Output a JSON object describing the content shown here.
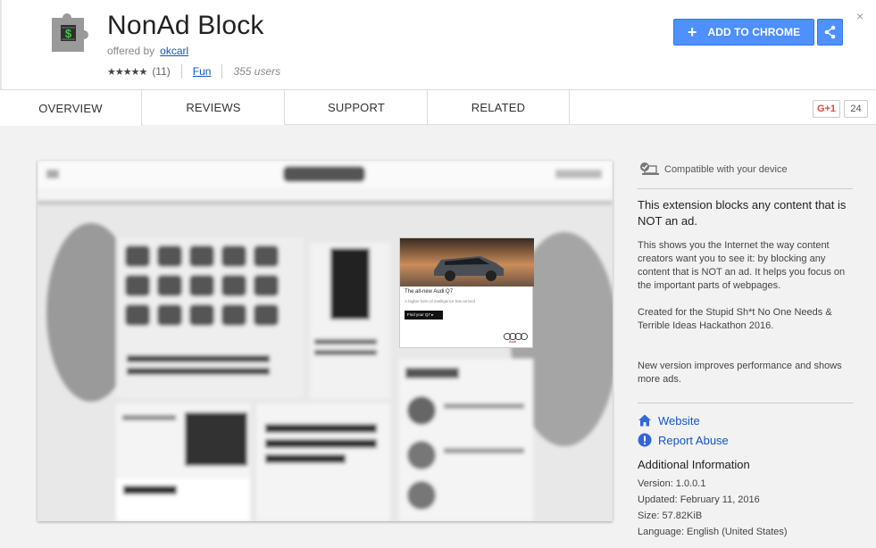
{
  "header": {
    "title": "NonAd Block",
    "offered_by_label": "offered by",
    "offered_by": "okcarl",
    "stars": "★★★★★",
    "rating_count": "(11)",
    "category": "Fun",
    "users": "355 users",
    "add_button": "ADD TO CHROME",
    "close": "×"
  },
  "tabs": [
    {
      "label": "OVERVIEW"
    },
    {
      "label": "REVIEWS"
    },
    {
      "label": "SUPPORT"
    },
    {
      "label": "RELATED"
    }
  ],
  "gplus": {
    "label": "G+1",
    "count": "24"
  },
  "screenshot": {
    "ad_title": "The all-new Audi Q7",
    "ad_subtitle": "A higher form of intelligence has arrived",
    "ad_button": "Find your Q7 ▸",
    "ad_brand": "Audi"
  },
  "sidebar": {
    "compat": "Compatible with your device",
    "summary": "This extension blocks any content that is NOT an ad.",
    "desc1": "This shows you the Internet the way content creators want you to see it: by blocking any content that is NOT an ad. It helps you focus on the important parts of webpages.",
    "desc2": "Created for the Stupid Sh*t No One Needs & Terrible Ideas Hackathon 2016.",
    "desc3": "New version improves performance and shows more ads.",
    "website": "Website",
    "report": "Report Abuse",
    "addl_title": "Additional Information",
    "version": "Version: 1.0.0.1",
    "updated": "Updated: February 11, 2016",
    "size": "Size: 57.82KiB",
    "language": "Language: English (United States)"
  },
  "colors": {
    "accent": "#4d90fe",
    "link": "#1155cc",
    "gplus_red": "#dd4b39"
  }
}
